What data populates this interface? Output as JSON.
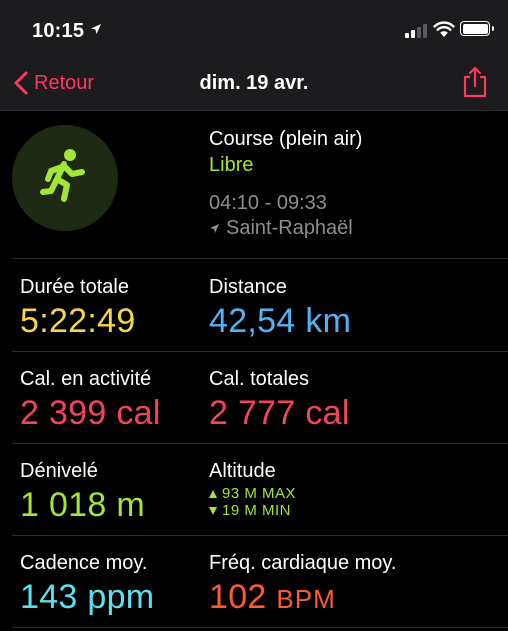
{
  "status_bar": {
    "time": "10:15",
    "icons": [
      "location-arrow-icon",
      "signal-icon",
      "wifi-icon",
      "battery-icon"
    ]
  },
  "nav": {
    "back_label": "Retour",
    "title": "dim. 19 avr.",
    "accent_color": "#ff375f"
  },
  "workout": {
    "activity_name": "Course (plein air)",
    "goal_type": "Libre",
    "time_range": "04:10 - 09:33",
    "location": "Saint-Raphaël",
    "icon": "running-figure-icon"
  },
  "metrics": {
    "duration": {
      "label": "Durée totale",
      "value": "5:22:49",
      "color": "#f5d54a"
    },
    "distance": {
      "label": "Distance",
      "value": "42,54 km",
      "color": "#52b2f5"
    },
    "active_cal": {
      "label": "Cal. en activité",
      "value": "2 399 cal",
      "color": "#f2455d"
    },
    "total_cal": {
      "label": "Cal. totales",
      "value": "2 777 cal",
      "color": "#f2455d"
    },
    "elevation": {
      "label": "Dénivelé",
      "value": "1 018 m",
      "color": "#a3e635"
    },
    "altitude": {
      "label": "Altitude",
      "max": "93 M MAX",
      "min": "19 M MIN",
      "color": "#a3e635"
    },
    "cadence": {
      "label": "Cadence moy.",
      "value": "143 ppm",
      "color": "#5ee1ee"
    },
    "heart_rate": {
      "label": "Fréq. cardiaque moy.",
      "value_number": "102",
      "value_unit": "BPM",
      "color": "#ff5a36"
    }
  }
}
